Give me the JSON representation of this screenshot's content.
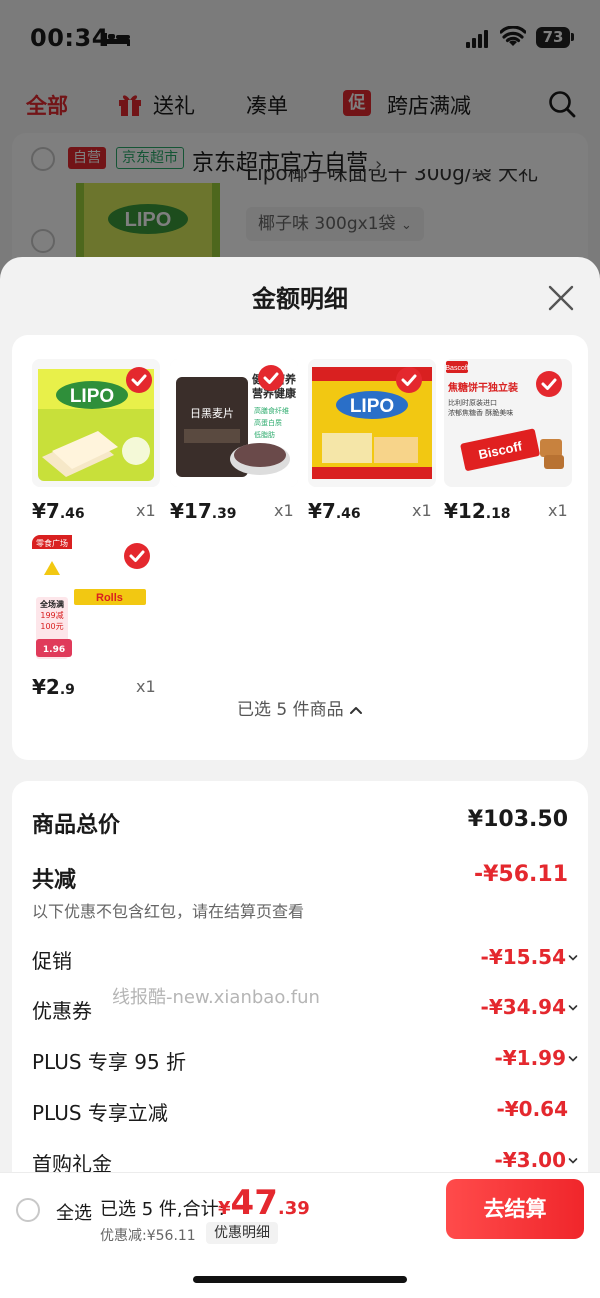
{
  "status_bar": {
    "time": "00:34",
    "battery": "73"
  },
  "tabs": [
    {
      "label": "全部",
      "active": true
    },
    {
      "label": "送礼",
      "icon": "gift-icon"
    },
    {
      "label": "凑单"
    },
    {
      "label": "跨店满减",
      "badge": "促"
    }
  ],
  "store": {
    "tag_self": "自营",
    "tag_market": "京东超市",
    "name": "京东超市官方自营",
    "chevron": "›",
    "item_title_partial": "Lipo椰子味面包干 300g/袋 大礼",
    "spec": "椰子味 300gx1袋"
  },
  "sheet": {
    "title": "金额明细",
    "goods": [
      {
        "name": "Lipo椰子味面包干",
        "price_int": "¥7",
        "price_dec": ".46",
        "qty": "x1",
        "checked": true
      },
      {
        "name": "黑麦片",
        "price_int": "¥17",
        "price_dec": ".39",
        "qty": "x1",
        "checked": true
      },
      {
        "name": "Lipo面包干",
        "price_int": "¥7",
        "price_dec": ".46",
        "qty": "x1",
        "checked": true
      },
      {
        "name": "Biscoff焦糖饼干",
        "price_int": "¥12",
        "price_dec": ".18",
        "qty": "x1",
        "checked": true
      },
      {
        "name": "Rolls",
        "price_int": "¥2",
        "price_dec": ".9",
        "qty": "x1",
        "checked": true
      }
    ],
    "goods_img_text": {
      "lipo": "LIPO",
      "oat_title": "日黑麦片",
      "oat_side_1": "健康营养",
      "oat_side_2": "营养健康",
      "oat_b1": "高膳食纤维",
      "oat_b2": "高蛋白质",
      "oat_b3": "低脂肪",
      "biscoff_brand": "Bascoff",
      "biscoff_head": "焦糖饼干独立装",
      "biscoff_sub1": "比利时原装进口",
      "biscoff_sub2": "浓郁焦糖香 酥脆美味",
      "biscoff_word": "Biscoff",
      "rolls_store": "零食广场",
      "rolls_promo1": "全场满",
      "rolls_promo2": "199减",
      "rolls_promo3": "100元",
      "rolls_price": "1.96",
      "rolls_word": "Rolls"
    },
    "selected_summary": "已选 5 件商品",
    "details": {
      "total_label": "商品总价",
      "total_value": "¥103.50",
      "reduce_label": "共减",
      "reduce_value": "-¥56.11",
      "reduce_note": "以下优惠不包含红包，请在结算页查看",
      "rows": [
        {
          "label": "促销",
          "value": "-¥15.54",
          "expandable": true
        },
        {
          "label": "优惠券",
          "value": "-¥34.94",
          "expandable": true
        },
        {
          "label": "PLUS 专享 95 折",
          "value": "-¥1.99",
          "expandable": true
        },
        {
          "label": "PLUS 专享立减",
          "value": "-¥0.64",
          "expandable": false
        },
        {
          "label": "首购礼金",
          "value": "-¥3.00",
          "expandable": true
        }
      ]
    },
    "watermark": "线报酷-new.xianbao.fun"
  },
  "checkout": {
    "select_all": "全选",
    "count_text": "已选 5 件,合计:",
    "total_yen": "¥",
    "total_int": "47",
    "total_dec": ".39",
    "discount_text": "优惠减:¥56.11",
    "detail_pill": "优惠明细",
    "button": "去结算"
  },
  "colors": {
    "accent": "#e4282e",
    "plus_green": "#2aaa6b"
  }
}
